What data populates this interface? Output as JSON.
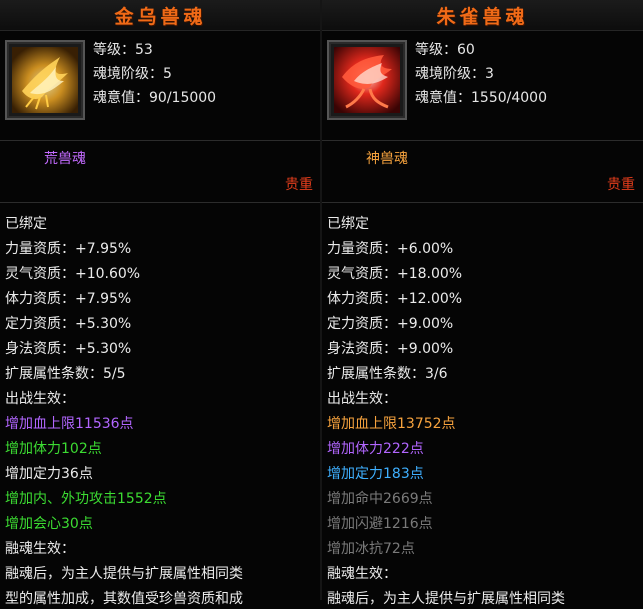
{
  "left": {
    "title": "金乌兽魂",
    "stats": [
      {
        "label": "等级",
        "value": "53"
      },
      {
        "label": "魂境阶级",
        "value": "5"
      },
      {
        "label": "魂意值",
        "value": "90/15000"
      }
    ],
    "rarity": "荒兽魂",
    "worth": "贵重",
    "bound": "已绑定",
    "attributes": [
      {
        "label": "力量资质",
        "value": "+7.95%"
      },
      {
        "label": "灵气资质",
        "value": "+10.60%"
      },
      {
        "label": "体力资质",
        "value": "+7.95%"
      },
      {
        "label": "定力资质",
        "value": "+5.30%"
      },
      {
        "label": "身法资质",
        "value": "+5.30%"
      }
    ],
    "ext_count": {
      "label": "扩展属性条数",
      "value": "5/5"
    },
    "battle_header": "出战生效：",
    "battle_effects": [
      "增加血上限11536点",
      "增加体力102点",
      "增加定力36点",
      "增加内、外功攻击1552点",
      "增加会心30点"
    ],
    "fusion_header": "融魂生效：",
    "fusion_text": [
      "融魂后，为主人提供与扩展属性相同类",
      "型的属性加成，其数值受珍兽资质和成"
    ]
  },
  "right": {
    "title": "朱雀兽魂",
    "stats": [
      {
        "label": "等级",
        "value": "60"
      },
      {
        "label": "魂境阶级",
        "value": "3"
      },
      {
        "label": "魂意值",
        "value": "1550/4000"
      }
    ],
    "rarity": "神兽魂",
    "worth": "贵重",
    "bound": "已绑定",
    "attributes": [
      {
        "label": "力量资质",
        "value": "+6.00%"
      },
      {
        "label": "灵气资质",
        "value": "+18.00%"
      },
      {
        "label": "体力资质",
        "value": "+12.00%"
      },
      {
        "label": "定力资质",
        "value": "+9.00%"
      },
      {
        "label": "身法资质",
        "value": "+9.00%"
      }
    ],
    "ext_count": {
      "label": "扩展属性条数",
      "value": "3/6"
    },
    "battle_header": "出战生效：",
    "battle_effects": [
      "增加血上限13752点",
      "增加体力222点",
      "增加定力183点",
      "增加命中2669点",
      "增加闪避1216点",
      "增加冰抗72点"
    ],
    "fusion_header": "融魂生效：",
    "fusion_text": [
      "融魂后，为主人提供与扩展属性相同类"
    ]
  },
  "colors": {
    "title": "#f06a17",
    "worth": "#e23d1c",
    "left_rarity": "#c36bff",
    "right_rarity": "#f7a33e"
  },
  "icons": {
    "left": "golden-phoenix-icon",
    "right": "vermilion-bird-icon"
  }
}
